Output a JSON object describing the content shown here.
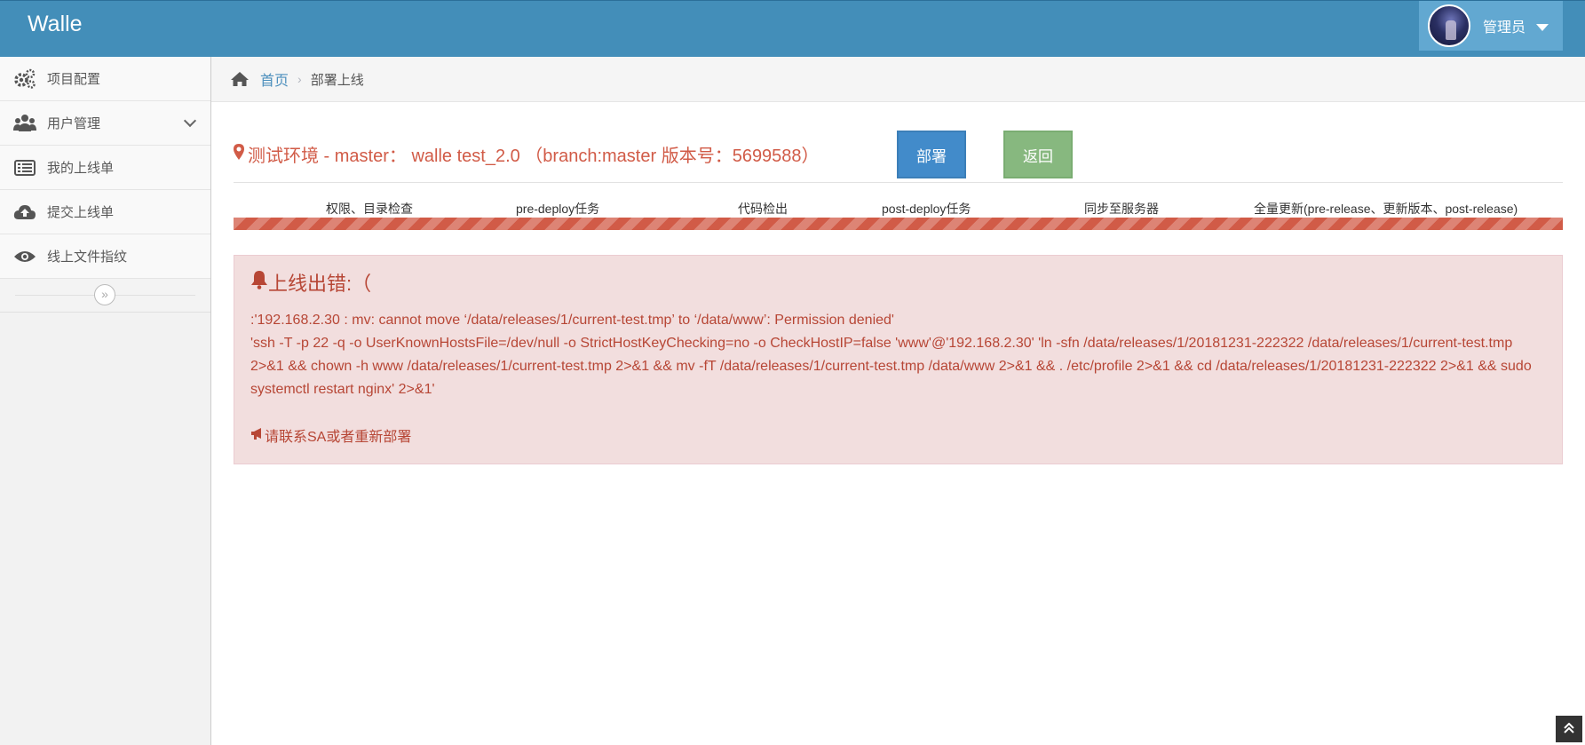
{
  "app": {
    "title": "Walle"
  },
  "user": {
    "name": "管理员"
  },
  "sidebar": {
    "items": [
      {
        "label": "项目配置",
        "icon": "cogs-icon"
      },
      {
        "label": "用户管理",
        "icon": "users-icon"
      },
      {
        "label": "我的上线单",
        "icon": "list-icon"
      },
      {
        "label": "提交上线单",
        "icon": "cloud-upload-icon"
      },
      {
        "label": "线上文件指纹",
        "icon": "eye-icon"
      }
    ],
    "collapse_icon": "double-chevron-right-icon"
  },
  "breadcrumb": {
    "home": "首页",
    "current": "部署上线"
  },
  "deploy": {
    "title": "测试环境 - master：  walle test_2.0 （branch:master 版本号：5699588）",
    "deploy_label": "部署",
    "back_label": "返回",
    "steps": [
      "权限、目录检查",
      "pre-deploy任务",
      "代码检出",
      "post-deploy任务",
      "同步至服务器",
      "全量更新(pre-release、更新版本、post-release)"
    ],
    "progress_percent": 100,
    "progress_color": "#d15b47"
  },
  "error": {
    "title": "上线出错:（",
    "line1": ":'192.168.2.30 : mv: cannot move ‘/data/releases/1/current-test.tmp’ to ‘/data/www’: Permission denied'",
    "line2": "'ssh -T -p 22 -q -o UserKnownHostsFile=/dev/null -o StrictHostKeyChecking=no -o CheckHostIP=false 'www'@'192.168.2.30' 'ln -sfn /data/releases/1/20181231-222322 /data/releases/1/current-test.tmp 2>&1 && chown -h www /data/releases/1/current-test.tmp 2>&1 && mv -fT /data/releases/1/current-test.tmp /data/www 2>&1 && . /etc/profile 2>&1 && cd /data/releases/1/20181231-222322 2>&1 && sudo systemctl restart nginx' 2>&1'",
    "tip": "请联系SA或者重新部署"
  },
  "colors": {
    "navbar": "#438eb9",
    "danger": "#d15b47",
    "primary": "#428bca",
    "success": "#87b87f"
  }
}
